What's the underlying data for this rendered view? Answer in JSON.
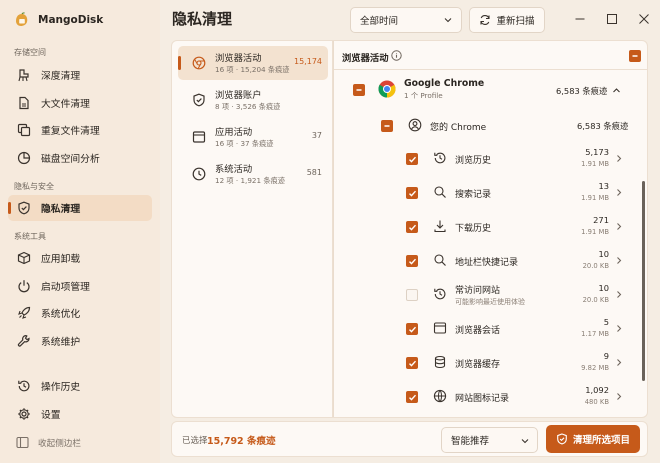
{
  "app": {
    "name": "MangoDisk"
  },
  "sidebar": {
    "sections": [
      {
        "label": "存储空间"
      },
      {
        "label": "隐私与安全"
      },
      {
        "label": "系统工具"
      }
    ],
    "items": [
      {
        "label": "深度清理",
        "icon": "broom-icon"
      },
      {
        "label": "大文件清理",
        "icon": "file-icon"
      },
      {
        "label": "重复文件清理",
        "icon": "copy-icon"
      },
      {
        "label": "磁盘空间分析",
        "icon": "pie-chart-icon"
      },
      {
        "label": "隐私清理",
        "icon": "shield-icon",
        "active": true
      },
      {
        "label": "应用卸载",
        "icon": "package-icon"
      },
      {
        "label": "启动项管理",
        "icon": "power-icon"
      },
      {
        "label": "系统优化",
        "icon": "rocket-icon"
      },
      {
        "label": "系统维护",
        "icon": "wrench-icon"
      },
      {
        "label": "操作历史",
        "icon": "history-icon"
      },
      {
        "label": "设置",
        "icon": "gear-icon"
      }
    ],
    "collapse_label": "收起侧边栏"
  },
  "header": {
    "title": "隐私清理",
    "time_filter": "全部时间",
    "rescan_label": "重新扫描"
  },
  "categories": [
    {
      "name": "浏览器活动",
      "sub": "16 项 · 15,204 条痕迹",
      "count": "15,174",
      "active": true
    },
    {
      "name": "浏览器账户",
      "sub": "8 项 · 3,526 条痕迹",
      "count": ""
    },
    {
      "name": "应用活动",
      "sub": "16 项 · 37 条痕迹",
      "count": "37"
    },
    {
      "name": "系统活动",
      "sub": "12 项 · 1,921 条痕迹",
      "count": "581"
    }
  ],
  "detail": {
    "title": "浏览器活动",
    "browser": {
      "name": "Google Chrome",
      "sub": "1 个 Profile",
      "count": "6,583 条痕迹"
    },
    "profile": {
      "name": "您的 Chrome",
      "count": "6,583 条痕迹"
    },
    "items": [
      {
        "name": "浏览历史",
        "count": "5,173",
        "size": "1.91 MB",
        "checked": true,
        "icon": "history-icon"
      },
      {
        "name": "搜索记录",
        "count": "13",
        "size": "1.91 MB",
        "checked": true,
        "icon": "search-icon"
      },
      {
        "name": "下载历史",
        "count": "271",
        "size": "1.91 MB",
        "checked": true,
        "icon": "download-icon"
      },
      {
        "name": "地址栏快捷记录",
        "count": "10",
        "size": "20.0 KB",
        "checked": true,
        "icon": "search-icon"
      },
      {
        "name": "常访问网站",
        "hint": "可能影响最近使用体验",
        "count": "10",
        "size": "20.0 KB",
        "checked": false,
        "icon": "history-icon"
      },
      {
        "name": "浏览器会话",
        "count": "5",
        "size": "1.17 MB",
        "checked": true,
        "icon": "window-icon"
      },
      {
        "name": "浏览器缓存",
        "count": "9",
        "size": "9.82 MB",
        "checked": true,
        "icon": "database-icon"
      },
      {
        "name": "网站图标记录",
        "count": "1,092",
        "size": "480 KB",
        "checked": true,
        "icon": "globe-icon"
      }
    ]
  },
  "footer": {
    "selected_label": "已选择",
    "selected_value": "15,792 条痕迹",
    "smart_select": "智能推荐",
    "clean_label": "清理所选项目"
  },
  "colors": {
    "accent": "#c65a1a",
    "sidebar_bg": "#f6eadd",
    "panel_bg": "#fdf9f5"
  }
}
